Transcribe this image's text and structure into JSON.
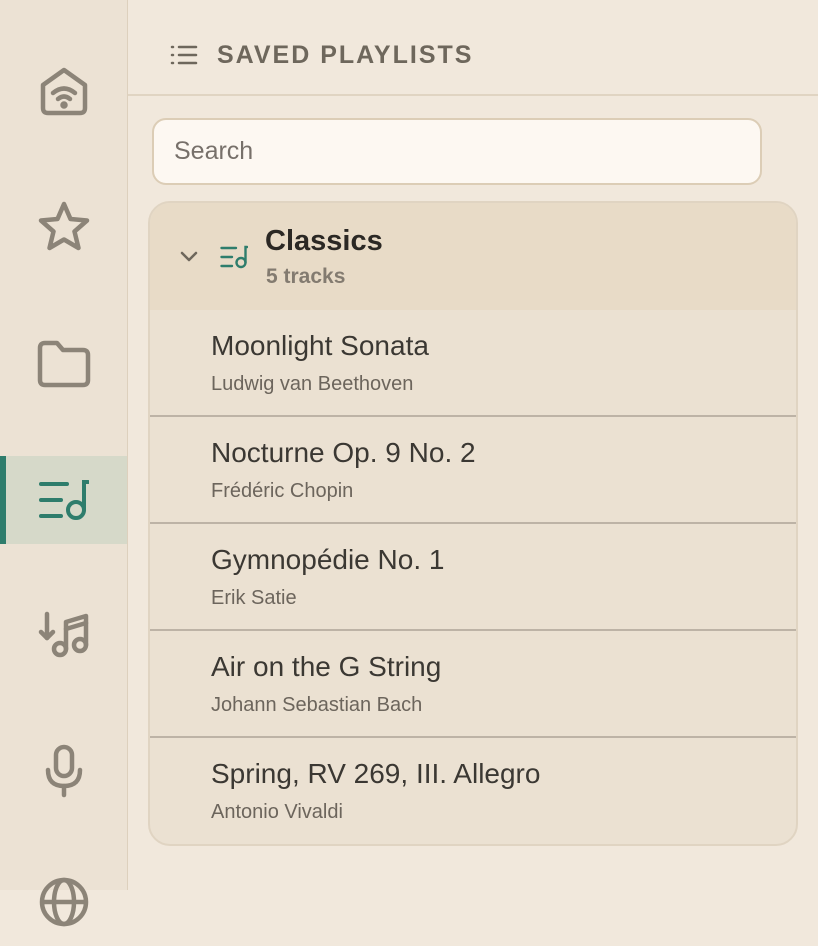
{
  "sidebar": {
    "items": [
      {
        "icon": "smart-home-icon",
        "active": false
      },
      {
        "icon": "star-icon",
        "active": false
      },
      {
        "icon": "folder-icon",
        "active": false
      },
      {
        "icon": "playlist-icon",
        "active": true
      },
      {
        "icon": "music-download-icon",
        "active": false
      },
      {
        "icon": "microphone-icon",
        "active": false
      },
      {
        "icon": "globe-icon",
        "active": false
      }
    ]
  },
  "header": {
    "icon": "list-icon",
    "title": "SAVED PLAYLISTS"
  },
  "search": {
    "placeholder": "Search",
    "value": ""
  },
  "playlist": {
    "name": "Classics",
    "count_label": "5 tracks",
    "expanded": true,
    "accent_color": "#2e7d6c",
    "tracks": [
      {
        "title": "Moonlight Sonata",
        "artist": "Ludwig van Beethoven"
      },
      {
        "title": "Nocturne Op. 9 No. 2",
        "artist": "Frédéric Chopin"
      },
      {
        "title": "Gymnopédie No. 1",
        "artist": "Erik Satie"
      },
      {
        "title": "Air on the G String",
        "artist": "Johann Sebastian Bach"
      },
      {
        "title": "Spring, RV 269, III. Allegro",
        "artist": "Antonio Vivaldi"
      }
    ]
  }
}
